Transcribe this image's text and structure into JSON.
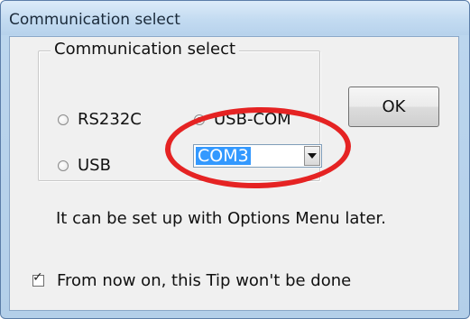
{
  "window": {
    "title": "Communication select"
  },
  "group": {
    "label": "Communication select",
    "options": [
      {
        "label": "RS232C",
        "checked": false
      },
      {
        "label": "USB-COM",
        "checked": true
      },
      {
        "label": "USB",
        "checked": false
      }
    ]
  },
  "combo": {
    "selected": "COM3"
  },
  "ok_label": "OK",
  "info_text": "It can be set up with Options Menu later.",
  "checkbox": {
    "label": "From now on, this Tip won't be done",
    "checked": true,
    "mark": "☑"
  },
  "colors": {
    "highlight": "#e52323",
    "selection": "#3399ff"
  }
}
